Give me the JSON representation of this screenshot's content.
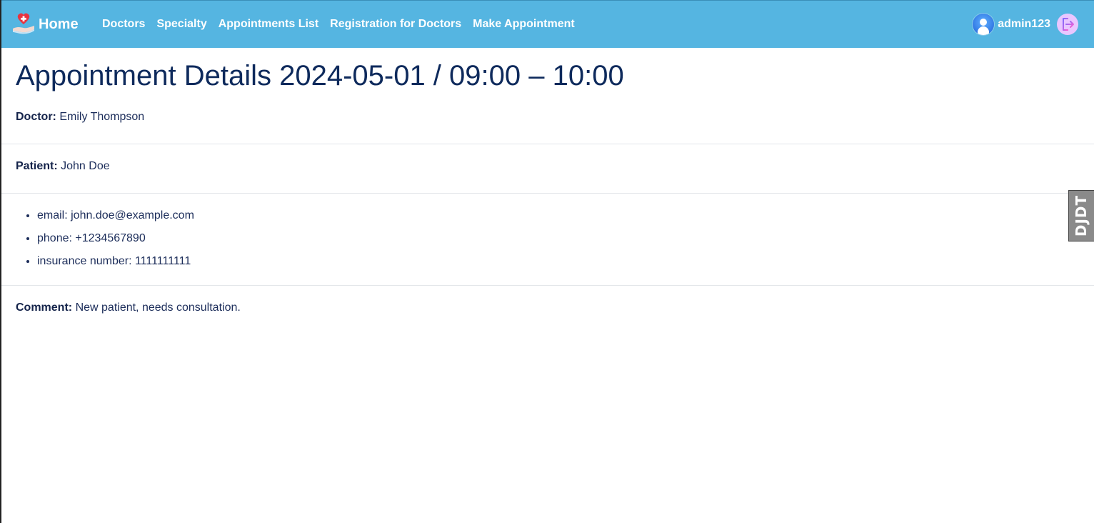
{
  "navbar": {
    "brand_label": "Home",
    "links": [
      "Doctors",
      "Specialty",
      "Appointments List",
      "Registration for Doctors",
      "Make Appointment"
    ],
    "username": "admin123",
    "logo_icon": "hand-heart-icon",
    "avatar_icon": "user-avatar-icon",
    "logout_icon": "logout-icon",
    "background_color": "#55b5e1"
  },
  "appointment": {
    "title": "Appointment Details 2024-05-01 / 09:00 – 10:00",
    "doctor_label": "Doctor:",
    "doctor_value": "Emily Thompson",
    "patient_label": "Patient:",
    "patient_value": "John Doe",
    "contact": [
      "email: john.doe@example.com",
      "phone: +1234567890",
      "insurance number: 1111111111"
    ],
    "comment_label": "Comment:",
    "comment_value": "New patient, needs consultation."
  },
  "debug_toolbar": {
    "label": "DJDT"
  }
}
